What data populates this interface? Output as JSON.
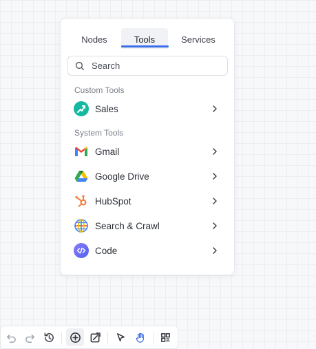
{
  "tabs": [
    {
      "label": "Nodes",
      "active": false
    },
    {
      "label": "Tools",
      "active": true
    },
    {
      "label": "Services",
      "active": false
    }
  ],
  "search": {
    "placeholder": "Search"
  },
  "sections": {
    "custom_label": "Custom Tools",
    "system_label": "System Tools"
  },
  "custom_tools": [
    {
      "label": "Sales",
      "icon": "sales-icon"
    }
  ],
  "system_tools": [
    {
      "label": "Gmail",
      "icon": "gmail-icon"
    },
    {
      "label": "Google Drive",
      "icon": "google-drive-icon"
    },
    {
      "label": "HubSpot",
      "icon": "hubspot-icon"
    },
    {
      "label": "Search & Crawl",
      "icon": "globe-icon"
    },
    {
      "label": "Code",
      "icon": "code-icon"
    }
  ],
  "colors": {
    "accent": "#3a6ee8",
    "sales": "#16b8a0",
    "hubspot": "#f57c3a",
    "code": "#6b6ef5"
  },
  "toolbar": [
    {
      "icon": "undo-icon"
    },
    {
      "icon": "redo-icon"
    },
    {
      "icon": "history-icon"
    },
    {
      "icon": "add-node-icon",
      "active": true
    },
    {
      "icon": "note-icon"
    },
    {
      "icon": "pointer-icon"
    },
    {
      "icon": "hand-icon"
    },
    {
      "icon": "layout-icon"
    }
  ]
}
